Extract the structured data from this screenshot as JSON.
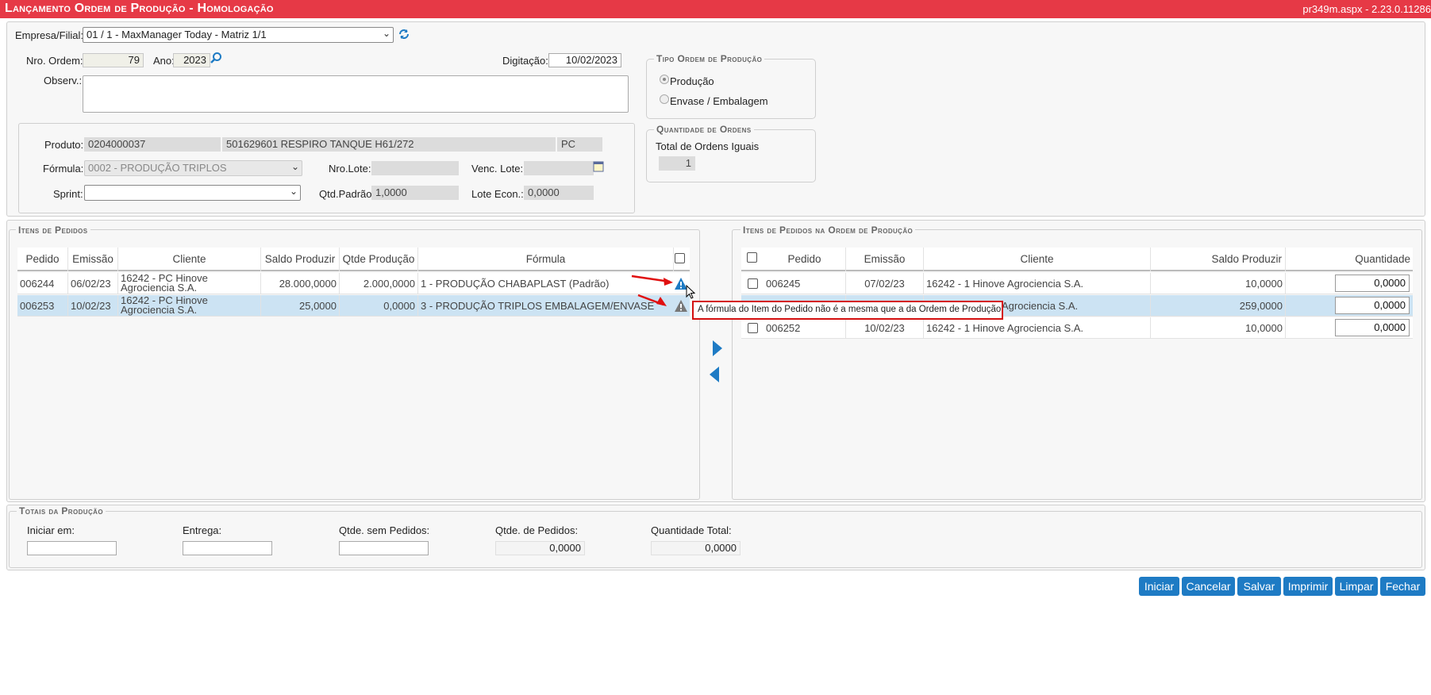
{
  "header": {
    "title": "Lançamento Ordem de Produção  - Homologação",
    "version": "pr349m.aspx - 2.23.0.11286"
  },
  "form": {
    "empresa_label": "Empresa/Filial:",
    "empresa_value": "01 / 1 - MaxManager Today - Matriz 1/1",
    "nro_ordem_label": "Nro. Ordem:",
    "nro_ordem_value": "79",
    "ano_label": "Ano:",
    "ano_value": "2023",
    "digitacao_label": "Digitação:",
    "digitacao_value": "10/02/2023",
    "observ_label": "Observ.:",
    "observ_value": "",
    "produto_label": "Produto:",
    "produto_code": "0204000037",
    "produto_desc": "501629601 RESPIRO TANQUE H61/272",
    "produto_un": "PC",
    "formula_label": "Fórmula:",
    "formula_value": "0002 - PRODUÇÃO TRIPLOS",
    "nro_lote_label": "Nro.Lote:",
    "nro_lote_value": "",
    "venc_lote_label": "Venc. Lote:",
    "venc_lote_value": "",
    "sprint_label": "Sprint:",
    "sprint_value": "",
    "qtd_padrao_label": "Qtd.Padrão:",
    "qtd_padrao_value": "1,0000",
    "lote_econ_label": "Lote Econ.:",
    "lote_econ_value": "0,0000"
  },
  "tipo_ordem": {
    "legend": "Tipo Ordem de Produção",
    "option1": "Produção",
    "option2": "Envase / Embalagem",
    "selected": "Produção"
  },
  "qtd_ordens": {
    "legend": "Quantidade de Ordens",
    "label": "Total de Ordens Iguais",
    "value": "1"
  },
  "itens_pedidos": {
    "legend": "Itens de Pedidos",
    "columns": [
      "Pedido",
      "Emissão",
      "Cliente",
      "Saldo Produzir",
      "Qtde Produção",
      "Fórmula"
    ],
    "rows": [
      {
        "pedido": "006244",
        "emissao": "06/02/23",
        "cliente": "16242 - PC Hinove Agrociencia S.A.",
        "saldo": "28.000,0000",
        "qtde": "2.000,0000",
        "formula": "1 - PRODUÇÃO CHABAPLAST (Padrão)",
        "icon": "warning-icon-blue"
      },
      {
        "pedido": "006253",
        "emissao": "10/02/23",
        "cliente": "16242 - PC Hinove Agrociencia S.A.",
        "saldo": "25,0000",
        "qtde": "0,0000",
        "formula": "3 - PRODUÇÃO TRIPLOS EMBALAGEM/ENVASE",
        "icon": "warning-icon-gray"
      }
    ]
  },
  "itens_ordem": {
    "legend": "Itens de Pedidos na Ordem de Produção",
    "columns": [
      "Pedido",
      "Emissão",
      "Cliente",
      "Saldo Produzir",
      "Quantidade"
    ],
    "rows": [
      {
        "pedido": "006245",
        "emissao": "07/02/23",
        "cliente": "16242 - 1 Hinove Agrociencia S.A.",
        "saldo": "10,0000",
        "quantidade": "0,0000"
      },
      {
        "pedido": "",
        "emissao": "",
        "cliente": "Agrociencia S.A.",
        "saldo": "259,0000",
        "quantidade": "0,0000"
      },
      {
        "pedido": "006252",
        "emissao": "10/02/23",
        "cliente": "16242 - 1 Hinove Agrociencia S.A.",
        "saldo": "10,0000",
        "quantidade": "0,0000"
      }
    ]
  },
  "tooltip": "A fórmula do Item do Pedido não é a mesma que a da Ordem de Produção!",
  "totais": {
    "legend": "Totais da Produção",
    "iniciar_label": "Iniciar em:",
    "iniciar_value": "",
    "entrega_label": "Entrega:",
    "entrega_value": "",
    "sem_pedidos_label": "Qtde. sem Pedidos:",
    "sem_pedidos_value": "",
    "de_pedidos_label": "Qtde. de Pedidos:",
    "de_pedidos_value": "0,0000",
    "total_label": "Quantidade Total:",
    "total_value": "0,0000"
  },
  "buttons": {
    "iniciar": "Iniciar",
    "cancelar": "Cancelar",
    "salvar": "Salvar",
    "imprimir": "Imprimir",
    "limpar": "Limpar",
    "fechar": "Fechar"
  },
  "colors": {
    "title_bar": "#e63946",
    "button": "#1e7bc4",
    "selected_row": "#cce3f3",
    "annotation": "#e01010"
  }
}
